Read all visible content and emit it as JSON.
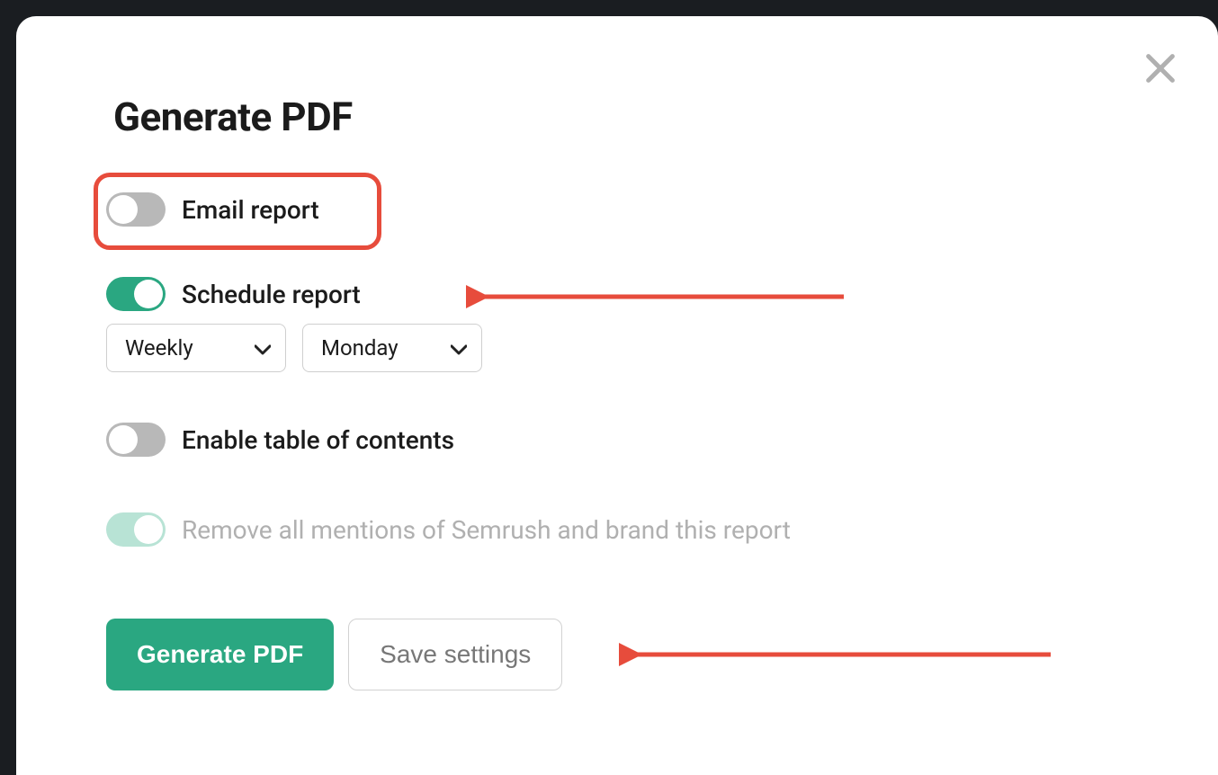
{
  "modal": {
    "title": "Generate PDF",
    "close_icon": "close-icon",
    "options": {
      "email_report": {
        "label": "Email report",
        "on": false,
        "highlighted": true
      },
      "schedule_report": {
        "label": "Schedule report",
        "on": true,
        "frequency": "Weekly",
        "day": "Monday",
        "annotated_arrow": true
      },
      "table_of_contents": {
        "label": "Enable table of contents",
        "on": false
      },
      "remove_branding": {
        "label": "Remove all mentions of Semrush and brand this report",
        "on": true,
        "disabled": true
      }
    },
    "buttons": {
      "generate": "Generate PDF",
      "save": "Save settings",
      "save_annotated_arrow": true
    }
  },
  "colors": {
    "accent": "#2aa781",
    "highlight": "#e74c3c"
  }
}
